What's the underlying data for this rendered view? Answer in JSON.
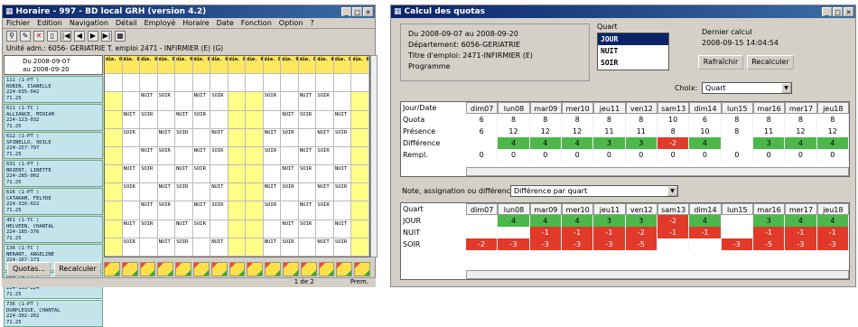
{
  "left": {
    "title": "Horaire - 997 - BD local GRH (version 4.2)",
    "menu": [
      "Fichier",
      "Edition",
      "Navigation",
      "Détail",
      "Employé",
      "Horaire",
      "Date",
      "Fonction",
      "Option",
      "?"
    ],
    "info": "Unité adm.: 6056- GERIATRIE   T. emploi 2471 - INFIRMIER (E) (G)",
    "date_from": "Du 2008-09-07",
    "date_to": "au 2008-09-20",
    "names": [
      [
        "111 (1-PT )",
        "ROBIN, ISABELLE",
        "224-035-042",
        "71.25"
      ],
      [
        "611 (1-TC )",
        "ALLIANCE, MIRIAM",
        "224-123-032",
        "71.25"
      ],
      [
        "612 (1-PT )",
        "SPINELLO, ODILE",
        "224-257-797",
        "71.25"
      ],
      [
        "631 (1-PT )",
        "BRIENT, LINETTE",
        "224-285-002",
        "71.25"
      ],
      [
        "616 (1-PT )",
        "CATAKAM, FELYDE",
        "224-316-022",
        "71.25"
      ],
      [
        "451 (1-TC )",
        "HELVEEN, CHANTAL",
        "224-185-376",
        "71.25"
      ],
      [
        "136 (1-TC )",
        "NERANT, ANGELINE",
        "224-167-173",
        "71.25"
      ],
      [
        "681 (1-PT )",
        "CADEF, CHRISTIANE",
        "224-133-224",
        "71.25"
      ],
      [
        "736 (1-PT )",
        "DURPLESSE, CHANTAL",
        "224-302-262",
        "71.25"
      ]
    ],
    "col_head": "dim. 09-07",
    "shift_codes": [
      "JOUR",
      "NUIT",
      "SOIR"
    ],
    "btn_quotas": "Quotas...",
    "btn_recalc": "Recalculer",
    "status": "1 de 2",
    "status_right": "Prem."
  },
  "right": {
    "title": "Calcul des quotas",
    "period": "Du 2008-09-07 au 2008-09-20",
    "dept": "Département:  6056-GERIATRIE",
    "job": "Titre d'emploi:  2471-INFIRMIER (E)",
    "prog": "Programme",
    "quart_label": "Quart",
    "quart_items": [
      "JOUR",
      "NUIT",
      "SOIR"
    ],
    "last_calc_label": "Dernier calcul",
    "last_calc": "2008-09-15 14:04:54",
    "btn_refresh": "Rafraîchir",
    "btn_recalc": "Recalculer",
    "choice_label": "Choix:",
    "choice_value": "Quart",
    "days": [
      "dim07",
      "lun08",
      "mar09",
      "mer10",
      "jeu11",
      "ven12",
      "sam13",
      "dim14",
      "lun15",
      "mar16",
      "mer17",
      "jeu18"
    ],
    "grid1_head": "Jour/Date",
    "rows1": [
      {
        "label": "Quota",
        "vals": [
          "6",
          "8",
          "8",
          "8",
          "8",
          "8",
          "10",
          "6",
          "8",
          "8",
          "8",
          "8"
        ]
      },
      {
        "label": "Présence",
        "vals": [
          "6",
          "12",
          "12",
          "12",
          "11",
          "11",
          "8",
          "10",
          "8",
          "11",
          "12",
          "12"
        ]
      },
      {
        "label": "Différence",
        "vals": [
          "",
          "4",
          "4",
          "4",
          "3",
          "3",
          "-2",
          "4",
          "",
          "3",
          "4",
          "4"
        ]
      },
      {
        "label": "Rempl.",
        "vals": [
          "0",
          "0",
          "0",
          "0",
          "0",
          "0",
          "0",
          "0",
          "0",
          "0",
          "0",
          "0"
        ]
      }
    ],
    "note_label": "Note, assignation ou différence:",
    "note_value": "Différence par quart",
    "grid2_head": "Quart",
    "rows2": [
      {
        "label": "JOUR",
        "vals": [
          "",
          "4",
          "4",
          "4",
          "3",
          "3",
          "-2",
          "4",
          "",
          "3",
          "4",
          "4"
        ]
      },
      {
        "label": "NUIT",
        "vals": [
          "",
          "",
          "-1",
          "-1",
          "-1",
          "-2",
          "-1",
          "-1",
          "",
          "-1",
          "-1",
          "-1"
        ]
      },
      {
        "label": "SOIR",
        "vals": [
          "-2",
          "-3",
          "-3",
          "-3",
          "-3",
          "-5",
          "",
          "",
          "-3",
          "-5",
          "-3",
          "-3"
        ]
      }
    ]
  }
}
